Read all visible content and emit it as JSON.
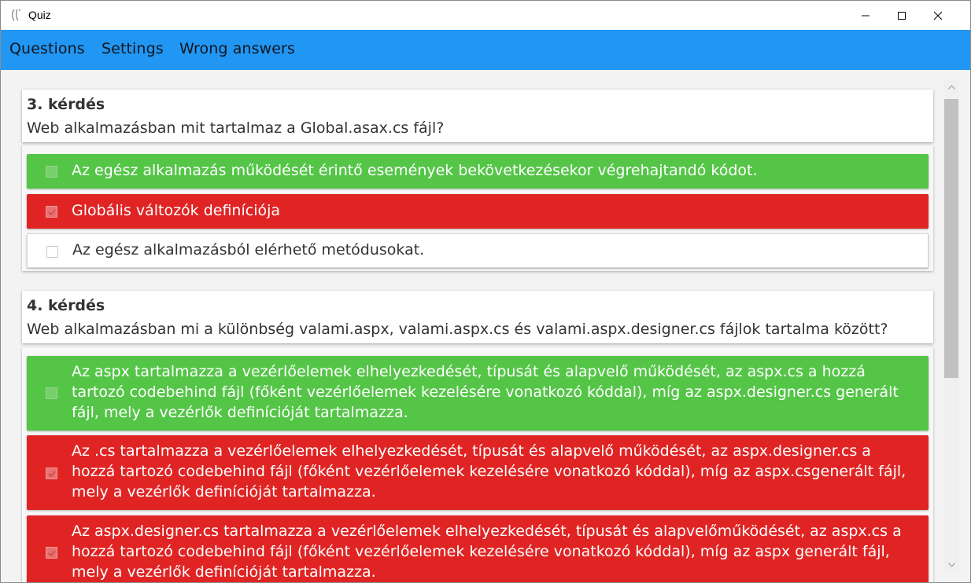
{
  "window": {
    "title": "Quiz"
  },
  "menu": {
    "items": [
      "Questions",
      "Settings",
      "Wrong answers"
    ]
  },
  "questions": [
    {
      "number": "3. kérdés",
      "text": "Web alkalmazásban mit tartalmaz a Global.asax.cs fájl?",
      "answers": [
        {
          "text": "Az egész alkalmazás működését érintő események bekövetkezésekor végrehajtandó kódot.",
          "status": "correct",
          "checked": false
        },
        {
          "text": "Globális változók definíciója",
          "status": "wrong",
          "checked": true
        },
        {
          "text": "Az egész alkalmazásból elérhető metódusokat.",
          "status": "neutral",
          "checked": false
        }
      ]
    },
    {
      "number": "4. kérdés",
      "text": "Web alkalmazásban mi a különbség valami.aspx, valami.aspx.cs és valami.aspx.designer.cs fájlok tartalma között?",
      "answers": [
        {
          "text": "Az aspx tartalmazza a vezérlőelemek elhelyezkedését, típusát és alapvelő működését, az aspx.cs a hozzá tartozó codebehind fájl (főként vezérlőelemek kezelésére vonatkozó kóddal), míg az aspx.designer.cs generált fájl, mely a vezérlők definícióját tartalmazza.",
          "status": "correct",
          "checked": false
        },
        {
          "text": "Az .cs tartalmazza a vezérlőelemek elhelyezkedését, típusát és alapvelő működését, az aspx.designer.cs a hozzá tartozó codebehind fájl (főként vezérlőelemek kezelésére vonatkozó kóddal), míg az aspx.csgenerált fájl, mely a vezérlők definícióját tartalmazza.",
          "status": "wrong",
          "checked": true
        },
        {
          "text": "Az aspx.designer.cs tartalmazza a vezérlőelemek elhelyezkedését, típusát és alapvelőműködését, az aspx.cs a hozzá tartozó codebehind fájl (főként vezérlőelemek kezelésére vonatkozó kóddal), míg az aspx generált fájl, mely a vezérlők definícióját tartalmazza.",
          "status": "wrong",
          "checked": true
        }
      ]
    }
  ],
  "colors": {
    "accent": "#2196f3",
    "correct": "#55c548",
    "wrong": "#e02424"
  }
}
